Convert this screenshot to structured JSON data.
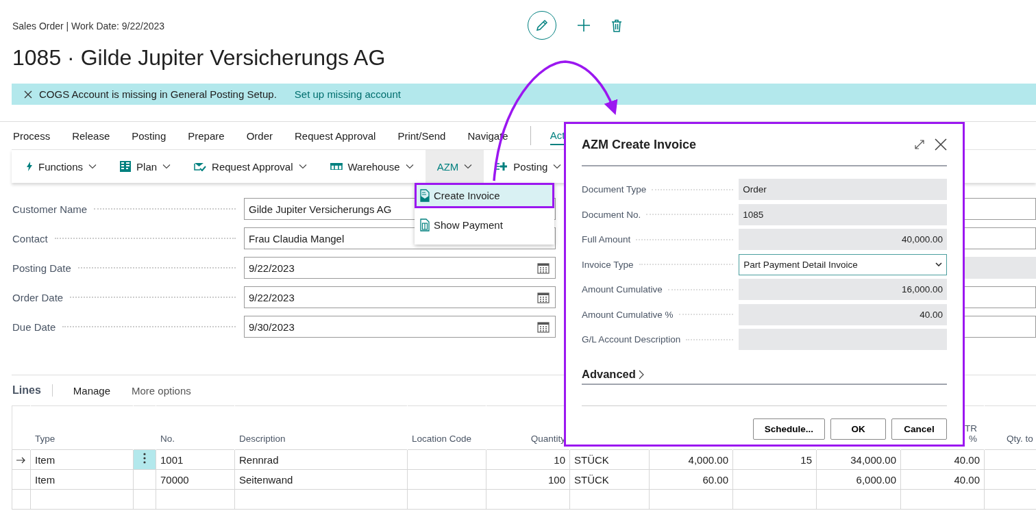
{
  "header": {
    "caption": "Sales Order | Work Date: 9/22/2023",
    "title": "1085 · Gilde Jupiter Versicherungs AG"
  },
  "notification": {
    "message": "COGS Account is missing in General Posting Setup.",
    "link": "Set up missing account"
  },
  "tabs": [
    {
      "label": "Process",
      "selected": false
    },
    {
      "label": "Release",
      "selected": false
    },
    {
      "label": "Posting",
      "selected": false
    },
    {
      "label": "Prepare",
      "selected": false
    },
    {
      "label": "Order",
      "selected": false
    },
    {
      "label": "Request Approval",
      "selected": false
    },
    {
      "label": "Print/Send",
      "selected": false
    },
    {
      "label": "Navigate",
      "selected": false
    },
    {
      "label": "Act",
      "selected": true
    }
  ],
  "action_bar": [
    {
      "label": "Functions",
      "selected": false
    },
    {
      "label": "Plan",
      "selected": false
    },
    {
      "label": "Request Approval",
      "selected": false
    },
    {
      "label": "Warehouse",
      "selected": false
    },
    {
      "label": "AZM",
      "selected": true
    },
    {
      "label": "Posting",
      "selected": false
    }
  ],
  "menu": {
    "items": [
      {
        "label": "Create Invoice",
        "selected": true
      },
      {
        "label": "Show Payment",
        "selected": false
      }
    ]
  },
  "fields": [
    {
      "label": "Customer Name",
      "value": "Gilde Jupiter Versicherungs AG",
      "kind": "text"
    },
    {
      "label": "Contact",
      "value": "Frau Claudia Mangel",
      "kind": "text"
    },
    {
      "label": "Posting Date",
      "value": "9/22/2023",
      "kind": "date"
    },
    {
      "label": "Order Date",
      "value": "9/22/2023",
      "kind": "date"
    },
    {
      "label": "Due Date",
      "value": "9/30/2023",
      "kind": "date"
    }
  ],
  "lines": {
    "title": "Lines",
    "actions": [
      "Manage",
      "More options"
    ],
    "columns": [
      "Type",
      null,
      "No.",
      "Description",
      "Location Code",
      "Quantity",
      null,
      null,
      null,
      null,
      "TR %",
      "Qty. to"
    ],
    "rows": [
      {
        "current": true,
        "cells": [
          "Item",
          null,
          "1001",
          "Rennrad",
          null,
          "10",
          "STÜCK",
          "4,000.00",
          "15",
          "34,000.00",
          "40.00",
          null
        ]
      },
      {
        "current": false,
        "cells": [
          "Item",
          null,
          "70000",
          "Seitenwand",
          null,
          "100",
          "STÜCK",
          "60.00",
          null,
          "6,000.00",
          "40.00",
          null
        ]
      }
    ]
  },
  "dialog": {
    "title": "AZM Create Invoice",
    "fields": [
      {
        "label": "Document Type",
        "value": "Order",
        "kind": "text"
      },
      {
        "label": "Document No.",
        "value": "1085",
        "kind": "text"
      },
      {
        "label": "Full Amount",
        "value": "40,000.00",
        "kind": "amount"
      },
      {
        "label": "Invoice Type",
        "value": "Part Payment Detail Invoice",
        "kind": "select"
      },
      {
        "label": "Amount Cumulative",
        "value": "16,000.00",
        "kind": "amount"
      },
      {
        "label": "Amount Cumulative %",
        "value": "40.00",
        "kind": "amount"
      },
      {
        "label": "G/L Account Description",
        "kind": "text"
      }
    ],
    "advanced": {
      "label": "Advanced",
      "expanded": false
    },
    "buttons": [
      "Schedule...",
      "OK",
      "Cancel"
    ]
  }
}
